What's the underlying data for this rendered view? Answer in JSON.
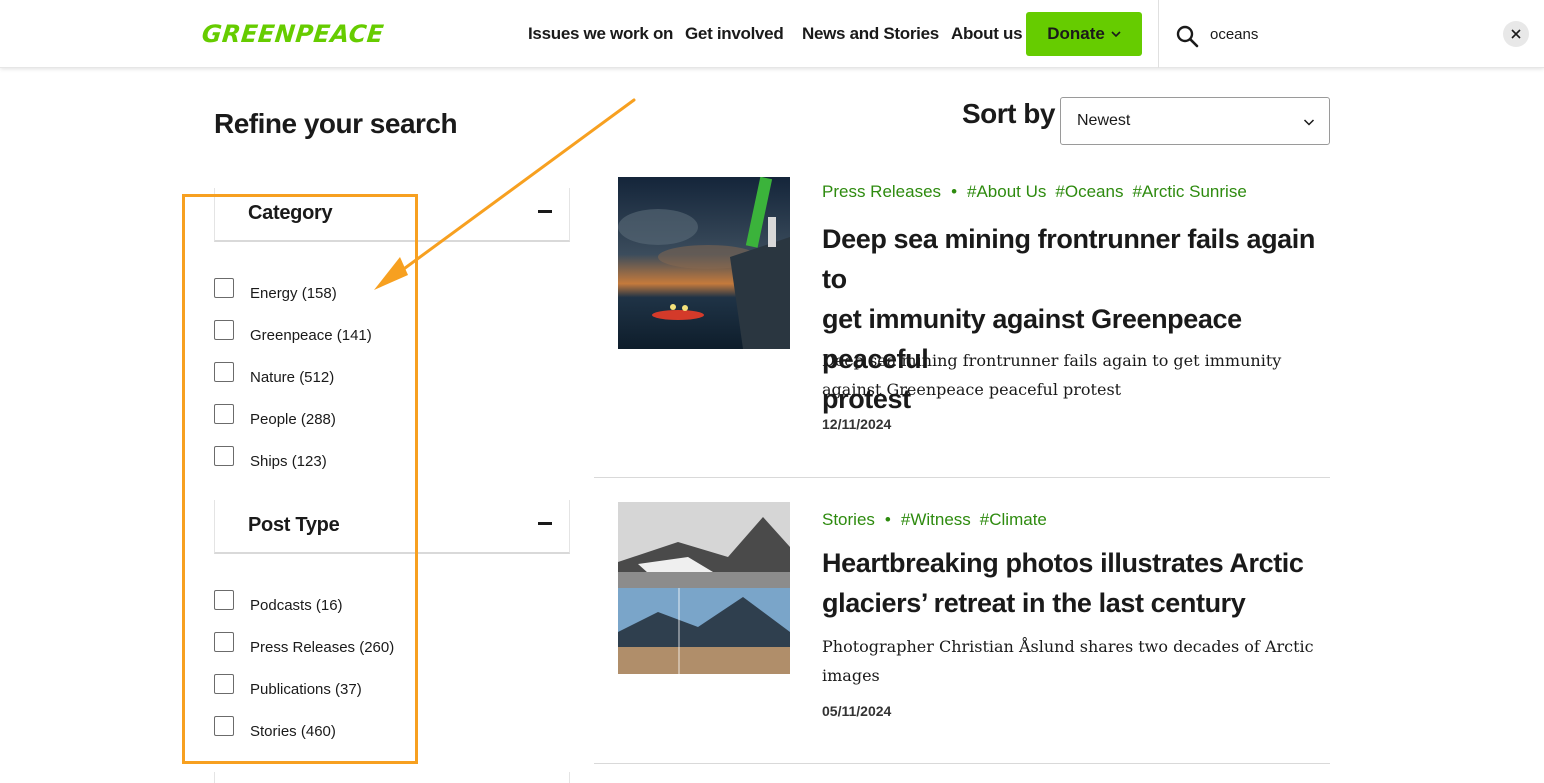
{
  "header": {
    "logo": "GREENPEACE",
    "nav": [
      "Issues we work on",
      "Get involved",
      "News and Stories",
      "About us"
    ],
    "donate_label": "Donate",
    "search_value": "oceans"
  },
  "sidebar": {
    "title": "Refine your search",
    "groups": [
      {
        "label": "Category",
        "options": [
          "Energy (158)",
          "Greenpeace (141)",
          "Nature (512)",
          "People (288)",
          "Ships (123)"
        ]
      },
      {
        "label": "Post Type",
        "options": [
          "Podcasts (16)",
          "Press Releases (260)",
          "Publications (37)",
          "Stories (460)"
        ]
      }
    ]
  },
  "sort": {
    "label": "Sort by",
    "selected": "Newest"
  },
  "results": [
    {
      "type": "Press Releases",
      "tags": [
        "#About Us",
        "#Oceans",
        "#Arctic Sunrise"
      ],
      "title_lines": [
        "Deep sea mining frontrunner fails again to",
        "get immunity against Greenpeace peaceful",
        "protest"
      ],
      "excerpt_lines": [
        "Deep sea mining frontrunner fails again to get immunity",
        "against Greenpeace peaceful protest"
      ],
      "date": "12/11/2024"
    },
    {
      "type": "Stories",
      "tags": [
        "#Witness",
        "#Climate"
      ],
      "title_lines": [
        "Heartbreaking photos illustrates Arctic",
        "glaciers’ retreat in the last century"
      ],
      "excerpt_lines": [
        "Photographer Christian Åslund shares two decades of Arctic",
        "images"
      ],
      "date": "05/11/2024"
    }
  ],
  "colors": {
    "brand_green": "#66cc00",
    "tag_green": "#2e8b0f",
    "annotation_orange": "#f7a020"
  }
}
